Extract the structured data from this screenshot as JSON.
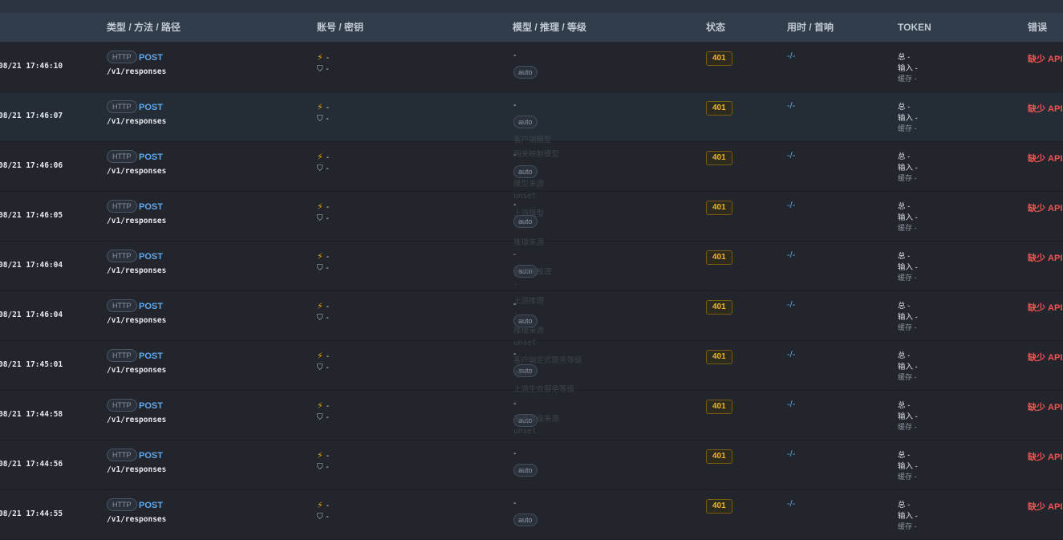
{
  "header": {
    "col_type": "类型 / 方法 / 路径",
    "col_account": "账号 / 密钥",
    "col_model": "模型 / 推理 / 等级",
    "col_status": "状态",
    "col_timing": "用时 / 首响",
    "col_token": "TOKEN",
    "col_error": "错误"
  },
  "labels": {
    "token_total": "总 -",
    "token_input": "输入 -",
    "token_cache": "缓存 -",
    "dash": "-"
  },
  "icons": {
    "bolt": "lightning-icon",
    "shield": "shield-icon"
  },
  "colors": {
    "accent_blue": "#5fa9f0",
    "status_amber": "#f2b425",
    "error_red": "#f25353",
    "bolt_amber": "#e0a21a"
  },
  "ghost_lines": [
    "客户端模型",
    "网关映射模型",
    "-",
    "模型来源",
    "unset",
    "上游模型",
    "-",
    "推理来源",
    "-",
    "客户端推理",
    "-",
    "上游推理",
    "-",
    "推理来源",
    "unset",
    "客户端定式服务等级",
    "auto",
    "上游生效服务等级",
    "-",
    "服务等级来源",
    "unset"
  ],
  "rows": [
    {
      "time": "08/21 17:46:10",
      "type": "HTTP",
      "method": "POST",
      "path": "/v1/responses",
      "account": "-",
      "key": "-",
      "model": "-",
      "reasoning": "auto",
      "status": "401",
      "timing": "-/-",
      "error": "缺少 API"
    },
    {
      "time": "08/21 17:46:07",
      "type": "HTTP",
      "method": "POST",
      "path": "/v1/responses",
      "account": "-",
      "key": "-",
      "model": "-",
      "reasoning": "auto",
      "status": "401",
      "timing": "-/-",
      "error": "缺少 API"
    },
    {
      "time": "08/21 17:46:06",
      "type": "HTTP",
      "method": "POST",
      "path": "/v1/responses",
      "account": "-",
      "key": "-",
      "model": "-",
      "reasoning": "auto",
      "status": "401",
      "timing": "-/-",
      "error": "缺少 API"
    },
    {
      "time": "08/21 17:46:05",
      "type": "HTTP",
      "method": "POST",
      "path": "/v1/responses",
      "account": "-",
      "key": "-",
      "model": "-",
      "reasoning": "auto",
      "status": "401",
      "timing": "-/-",
      "error": "缺少 API"
    },
    {
      "time": "08/21 17:46:04",
      "type": "HTTP",
      "method": "POST",
      "path": "/v1/responses",
      "account": "-",
      "key": "-",
      "model": "-",
      "reasoning": "auto",
      "status": "401",
      "timing": "-/-",
      "error": "缺少 API"
    },
    {
      "time": "08/21 17:46:04",
      "type": "HTTP",
      "method": "POST",
      "path": "/v1/responses",
      "account": "-",
      "key": "-",
      "model": "-",
      "reasoning": "auto",
      "status": "401",
      "timing": "-/-",
      "error": "缺少 API"
    },
    {
      "time": "08/21 17:45:01",
      "type": "HTTP",
      "method": "POST",
      "path": "/v1/responses",
      "account": "-",
      "key": "-",
      "model": "-",
      "reasoning": "auto",
      "status": "401",
      "timing": "-/-",
      "error": "缺少 API"
    },
    {
      "time": "08/21 17:44:58",
      "type": "HTTP",
      "method": "POST",
      "path": "/v1/responses",
      "account": "-",
      "key": "-",
      "model": "-",
      "reasoning": "auto",
      "status": "401",
      "timing": "-/-",
      "error": "缺少 API"
    },
    {
      "time": "08/21 17:44:56",
      "type": "HTTP",
      "method": "POST",
      "path": "/v1/responses",
      "account": "-",
      "key": "-",
      "model": "-",
      "reasoning": "auto",
      "status": "401",
      "timing": "-/-",
      "error": "缺少 API"
    },
    {
      "time": "08/21 17:44:55",
      "type": "HTTP",
      "method": "POST",
      "path": "/v1/responses",
      "account": "-",
      "key": "-",
      "model": "-",
      "reasoning": "auto",
      "status": "401",
      "timing": "-/-",
      "error": "缺少 API"
    }
  ]
}
